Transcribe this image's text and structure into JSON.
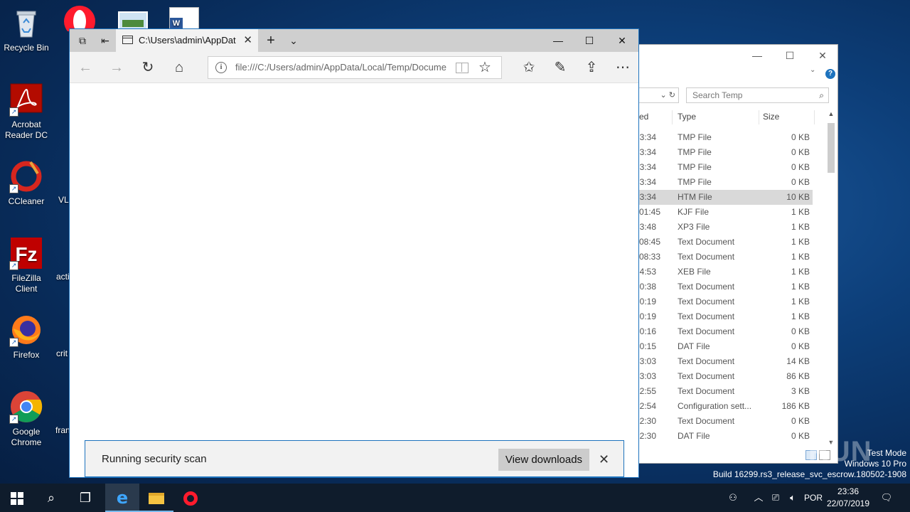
{
  "desktop": {
    "icons": [
      {
        "label": "Recycle Bin",
        "icon": "recycle-bin-icon"
      },
      {
        "label": "Acrobat Reader DC",
        "icon": "acrobat-reader-icon"
      },
      {
        "label": "CCleaner",
        "icon": "ccleaner-icon"
      },
      {
        "label": "FileZilla Client",
        "icon": "filezilla-icon"
      },
      {
        "label": "Firefox",
        "icon": "firefox-icon"
      },
      {
        "label": "Google Chrome",
        "icon": "chrome-icon"
      }
    ],
    "partial_labels": [
      "VL",
      "acti",
      "crit",
      "fran"
    ],
    "watermark": {
      "line1": "Test Mode",
      "line2": "Windows 10 Pro",
      "line3": "Build 16299.rs3_release_svc_escrow.180502-1908"
    },
    "brand_overlay": "ANY RUN"
  },
  "explorer": {
    "search_placeholder": "Search Temp",
    "columns": {
      "date_partial": "ed",
      "type": "Type",
      "size": "Size"
    },
    "rows": [
      {
        "time": "3:34",
        "type": "TMP File",
        "size": "0 KB"
      },
      {
        "time": "3:34",
        "type": "TMP File",
        "size": "0 KB"
      },
      {
        "time": "3:34",
        "type": "TMP File",
        "size": "0 KB"
      },
      {
        "time": "3:34",
        "type": "TMP File",
        "size": "0 KB"
      },
      {
        "time": "3:34",
        "type": "HTM File",
        "size": "10 KB",
        "selected": true
      },
      {
        "time": "01:45",
        "type": "KJF File",
        "size": "1 KB"
      },
      {
        "time": "3:48",
        "type": "XP3 File",
        "size": "1 KB"
      },
      {
        "time": "08:45",
        "type": "Text Document",
        "size": "1 KB"
      },
      {
        "time": "08:33",
        "type": "Text Document",
        "size": "1 KB"
      },
      {
        "time": "4:53",
        "type": "XEB File",
        "size": "1 KB"
      },
      {
        "time": "0:38",
        "type": "Text Document",
        "size": "1 KB"
      },
      {
        "time": "0:19",
        "type": "Text Document",
        "size": "1 KB"
      },
      {
        "time": "0:19",
        "type": "Text Document",
        "size": "1 KB"
      },
      {
        "time": "0:16",
        "type": "Text Document",
        "size": "0 KB"
      },
      {
        "time": "0:15",
        "type": "DAT File",
        "size": "0 KB"
      },
      {
        "time": "3:03",
        "type": "Text Document",
        "size": "14 KB"
      },
      {
        "time": "3:03",
        "type": "Text Document",
        "size": "86 KB"
      },
      {
        "time": "2:55",
        "type": "Text Document",
        "size": "3 KB"
      },
      {
        "time": "2:54",
        "type": "Configuration sett...",
        "size": "186 KB"
      },
      {
        "time": "2:30",
        "type": "Text Document",
        "size": "0 KB"
      },
      {
        "time": "2:30",
        "type": "DAT File",
        "size": "0 KB"
      }
    ]
  },
  "edge": {
    "tab_title": "C:\\Users\\admin\\AppDat",
    "url": "file:///C:/Users/admin/AppData/Local/Temp/Docume",
    "download_bar": {
      "message": "Running security scan",
      "view_downloads": "View downloads"
    }
  },
  "taskbar": {
    "language": "POR",
    "time": "23:36",
    "date": "22/07/2019"
  },
  "colors": {
    "accent": "#1e73be",
    "taskbar": "#0f1c2c",
    "selected_row": "#d9d9d9"
  }
}
